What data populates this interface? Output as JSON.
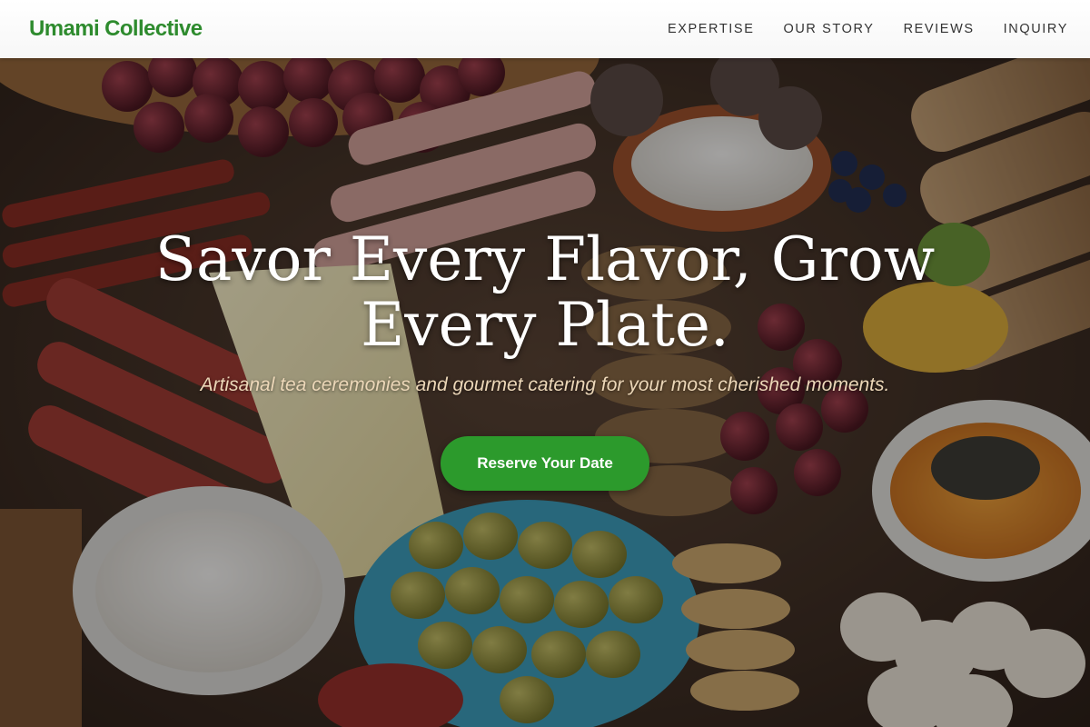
{
  "brand": {
    "name": "Umami Collective",
    "accent_color": "#2e8b2e"
  },
  "nav": {
    "items": [
      {
        "label": "EXPERTISE"
      },
      {
        "label": "OUR STORY"
      },
      {
        "label": "REVIEWS"
      },
      {
        "label": "INQUIRY"
      }
    ]
  },
  "hero": {
    "title": "Savor Every Flavor, Grow Every Plate.",
    "subtitle": "Artisanal tea ceremonies and gourmet catering for your most cherished moments.",
    "cta_label": "Reserve Your Date",
    "cta_color": "#2c9a2c",
    "background": "charcuterie-board-photo"
  }
}
